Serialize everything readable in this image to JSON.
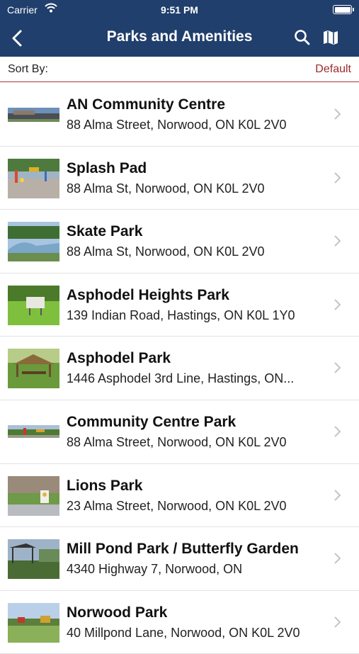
{
  "status_bar": {
    "carrier": "Carrier",
    "time": "9:51 PM"
  },
  "navbar": {
    "title": "Parks and Amenities"
  },
  "sort": {
    "label": "Sort By:",
    "value": "Default"
  },
  "colors": {
    "navbar": "#213f6c",
    "accent": "#9b2a2a",
    "separator": "#e2e2e2"
  },
  "icons": [
    "wifi-icon",
    "battery-icon",
    "back-chevron-icon",
    "search-icon",
    "map-icon",
    "chevron-right-icon"
  ],
  "items": [
    {
      "name": "AN Community Centre",
      "address": "88 Alma Street, Norwood, ON K0L 2V0"
    },
    {
      "name": "Splash Pad",
      "address": "88 Alma St, Norwood, ON K0L 2V0"
    },
    {
      "name": "Skate Park",
      "address": "88 Alma St, Norwood, ON K0L 2V0"
    },
    {
      "name": "Asphodel Heights Park",
      "address": "139 Indian Road, Hastings, ON K0L 1Y0"
    },
    {
      "name": "Asphodel Park",
      "address": "1446 Asphodel 3rd Line, Hastings, ON..."
    },
    {
      "name": "Community Centre Park",
      "address": "88 Alma Street, Norwood, ON K0L 2V0"
    },
    {
      "name": "Lions Park",
      "address": "23 Alma Street, Norwood, ON K0L 2V0"
    },
    {
      "name": "Mill Pond Park / Butterfly Garden",
      "address": "4340 Highway 7, Norwood, ON"
    },
    {
      "name": "Norwood Park",
      "address": "40 Millpond Lane, Norwood, ON K0L 2V0"
    }
  ]
}
